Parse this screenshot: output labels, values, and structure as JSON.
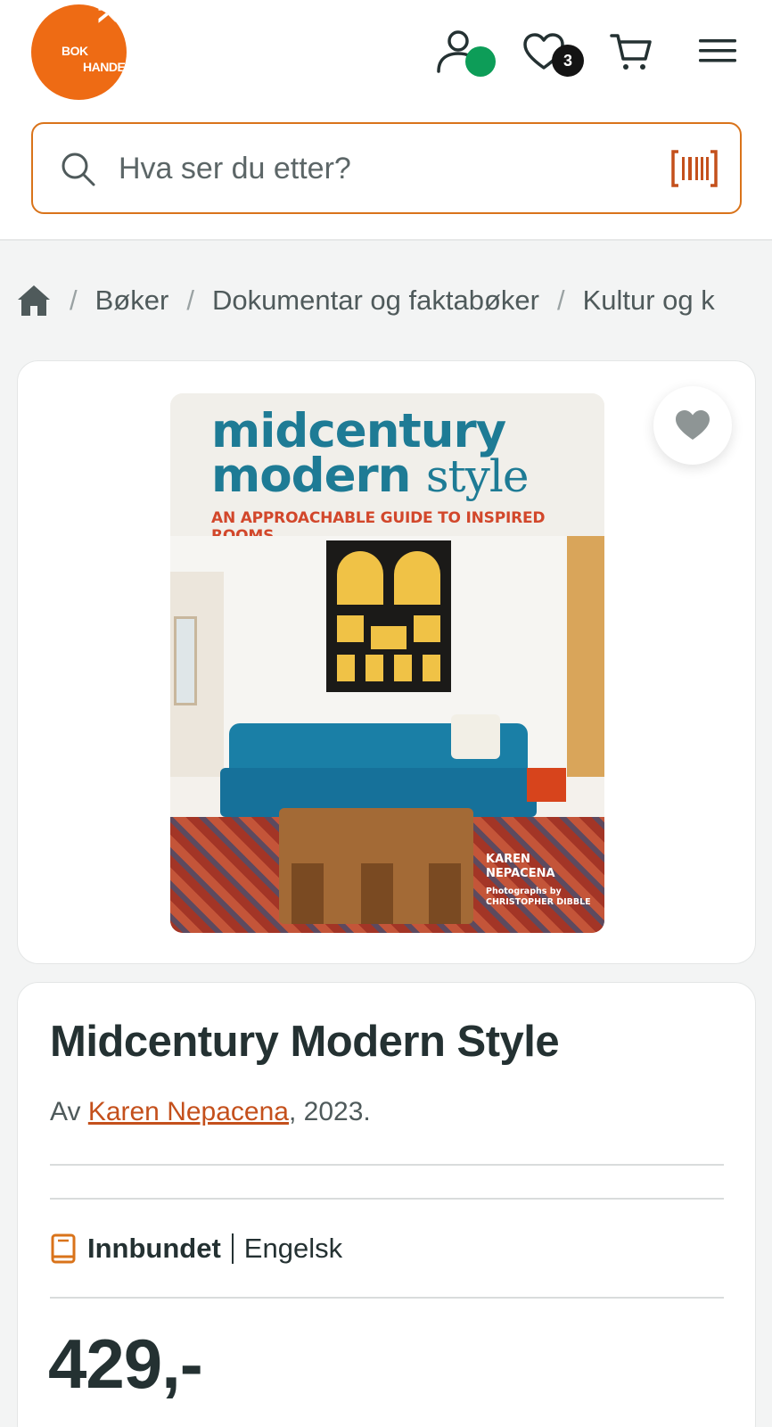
{
  "header": {
    "logo": {
      "line1": "ARK",
      "line2": "BOK",
      "line3": "HANDEL"
    },
    "wishlist_count": "3",
    "colors": {
      "brand": "#ee6b14",
      "status": "#0d9d58",
      "text": "#243132"
    },
    "icons": [
      "user-icon",
      "heart-icon",
      "cart-icon",
      "menu-icon"
    ]
  },
  "search": {
    "placeholder": "Hva ser du etter?",
    "value": "",
    "icons": [
      "search-icon",
      "barcode-icon"
    ]
  },
  "breadcrumb": {
    "home_icon": "home-icon",
    "separator": "/",
    "items": [
      "Bøker",
      "Dokumentar og faktabøker",
      "Kultur og k"
    ]
  },
  "cover": {
    "title_line1": "midcentury",
    "title_line2": "modern",
    "title_script": "style",
    "subtitle": "AN APPROACHABLE GUIDE TO INSPIRED ROOMS",
    "author_line1": "KAREN",
    "author_line2": "NEPACENA",
    "photo_line1": "Photographs by",
    "photo_line2": "CHRISTOPHER DIBBLE"
  },
  "product": {
    "title": "Midcentury Modern Style",
    "by_prefix": "Av ",
    "author": "Karen Nepacena",
    "year_suffix": ", 2023.",
    "binding": "Innbundet",
    "language": "Engelsk",
    "price": "429,-"
  }
}
